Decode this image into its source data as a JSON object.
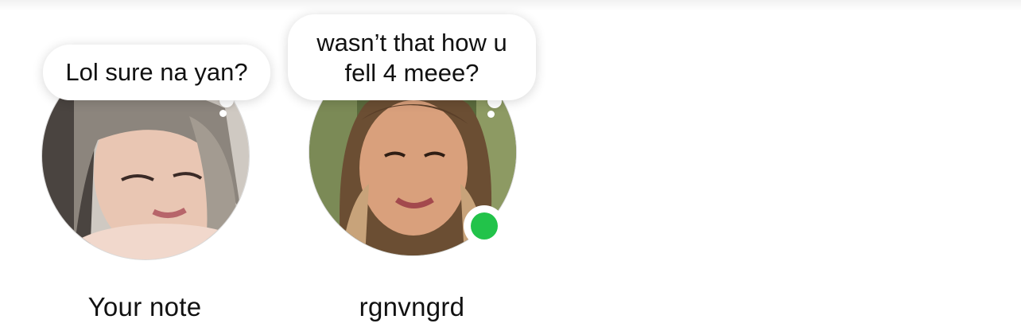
{
  "notes": [
    {
      "note_text": "Lol sure na yan?",
      "label": "Your note",
      "online": false
    },
    {
      "note_text": "wasn’t that how u\nfell 4 meee?",
      "label": "rgnvngrd",
      "online": true
    }
  ],
  "colors": {
    "online_status": "#22c34a",
    "bubble_bg": "#ffffff",
    "text": "#111111"
  }
}
